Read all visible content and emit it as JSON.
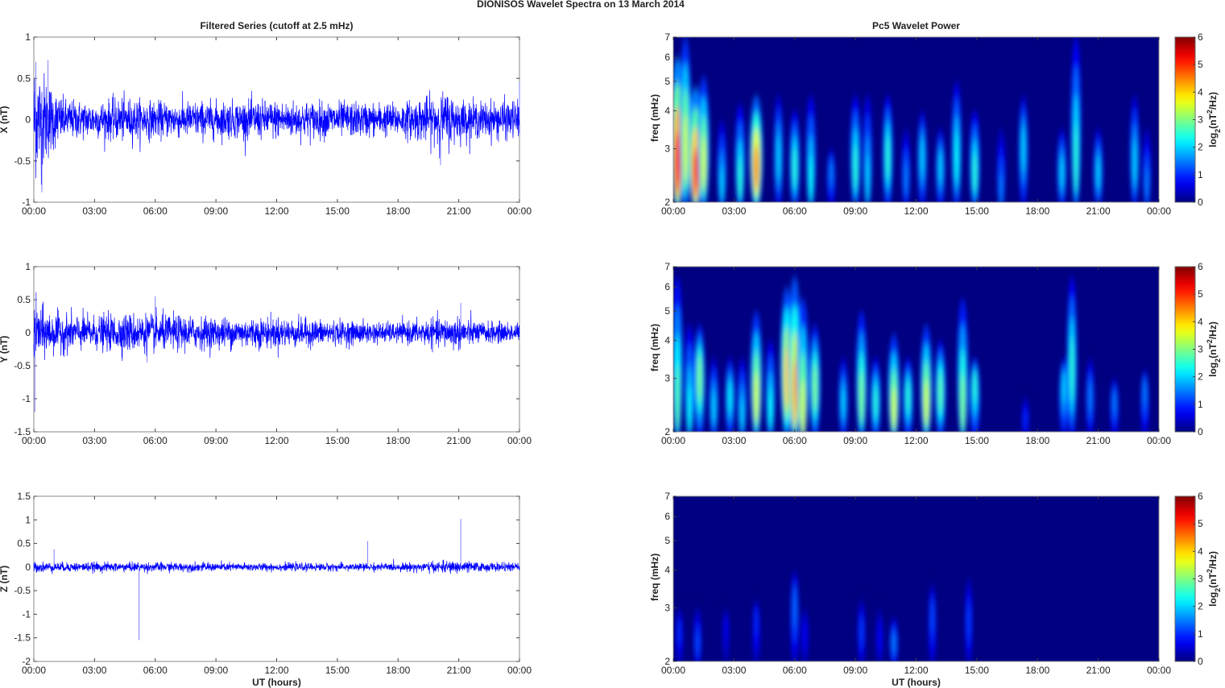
{
  "figure_title": "DIONISOS Wavelet Spectra on 13 March     2014",
  "chart_data": [
    {
      "type": "line",
      "title": "Filtered Series (cutoff at 2.5 mHz)",
      "ylabel": "X (nT)",
      "xlabel": "",
      "ylim": [
        -1,
        1
      ],
      "yticks": [
        "-1",
        "-0.5",
        "0",
        "0.5",
        "1"
      ],
      "xticks": [
        "00:00",
        "03:00",
        "06:00",
        "09:00",
        "12:00",
        "15:00",
        "18:00",
        "21:00",
        "00:00"
      ],
      "xlim_hours": [
        0,
        24
      ],
      "envelope": {
        "hours": [
          0,
          0.5,
          1,
          1.5,
          3,
          4.5,
          6,
          12,
          15,
          18,
          19.5,
          20.5,
          21,
          22,
          23,
          24
        ],
        "amp_nT": [
          0.45,
          0.35,
          0.22,
          0.15,
          0.13,
          0.16,
          0.13,
          0.14,
          0.13,
          0.12,
          0.17,
          0.2,
          0.15,
          0.13,
          0.14,
          0.14
        ]
      },
      "spikes": [
        {
          "hour": 0.1,
          "value_nT": 0.7
        },
        {
          "hour": 0.4,
          "value_nT": -0.88
        },
        {
          "hour": 0.7,
          "value_nT": 0.72
        },
        {
          "hour": 20.1,
          "value_nT": -0.55
        },
        {
          "hour": 24,
          "value_nT": 0.45
        }
      ],
      "color": "#0000ff"
    },
    {
      "type": "line",
      "ylabel": "Y (nT)",
      "xlabel": "",
      "ylim": [
        -1.5,
        1
      ],
      "yticks": [
        "-1.5",
        "-1",
        "-0.5",
        "0",
        "0.5",
        "1"
      ],
      "xticks": [
        "00:00",
        "03:00",
        "06:00",
        "09:00",
        "12:00",
        "15:00",
        "18:00",
        "21:00",
        "00:00"
      ],
      "xlim_hours": [
        0,
        24
      ],
      "envelope": {
        "hours": [
          0,
          0.5,
          1,
          3,
          4.5,
          6,
          9,
          12,
          15,
          18,
          20,
          21,
          22,
          24
        ],
        "amp_nT": [
          0.3,
          0.22,
          0.18,
          0.15,
          0.18,
          0.17,
          0.14,
          0.14,
          0.11,
          0.09,
          0.13,
          0.15,
          0.1,
          0.09
        ]
      },
      "spikes": [
        {
          "hour": 0.05,
          "value_nT": -1.2
        },
        {
          "hour": 0.1,
          "value_nT": 0.6
        },
        {
          "hour": 6.0,
          "value_nT": 0.55
        },
        {
          "hour": 5.6,
          "value_nT": -0.45
        },
        {
          "hour": 21.1,
          "value_nT": 0.45
        }
      ],
      "color": "#0000ff"
    },
    {
      "type": "line",
      "ylabel": "Z (nT)",
      "xlabel": "UT (hours)",
      "ylim": [
        -2,
        1.5
      ],
      "yticks": [
        "-2",
        "-1.5",
        "-1",
        "-0.5",
        "0",
        "0.5",
        "1",
        "1.5"
      ],
      "xticks": [
        "00:00",
        "03:00",
        "06:00",
        "09:00",
        "12:00",
        "15:00",
        "18:00",
        "21:00",
        "00:00"
      ],
      "xlim_hours": [
        0,
        24
      ],
      "envelope": {
        "hours": [
          0,
          1,
          6,
          12,
          18,
          20,
          21,
          22,
          24
        ],
        "amp_nT": [
          0.07,
          0.06,
          0.06,
          0.05,
          0.05,
          0.07,
          0.08,
          0.06,
          0.05
        ]
      },
      "spikes": [
        {
          "hour": 5.2,
          "value_nT": -1.55
        },
        {
          "hour": 16.5,
          "value_nT": 0.55
        },
        {
          "hour": 21.1,
          "value_nT": 1.02
        },
        {
          "hour": 1.0,
          "value_nT": 0.38
        }
      ],
      "color": "#0000ff"
    },
    {
      "type": "heatmap",
      "title": "Pc5 Wavelet Power",
      "ylabel": "freq (mHz)",
      "xlabel": "",
      "yscale": "log",
      "ylim": [
        2,
        7
      ],
      "yticks": [
        "2",
        "3",
        "4",
        "5",
        "6",
        "7"
      ],
      "xticks": [
        "00:00",
        "03:00",
        "06:00",
        "09:00",
        "12:00",
        "15:00",
        "18:00",
        "21:00",
        "00:00"
      ],
      "colorbar": {
        "label": "log2(nT2/Hz)",
        "range": [
          0,
          6
        ],
        "ticks": [
          "0",
          "1",
          "2",
          "3",
          "4",
          "5",
          "6"
        ]
      },
      "blobs": [
        [
          0.2,
          2.7,
          6,
          5.2
        ],
        [
          0.6,
          3,
          7,
          3.5
        ],
        [
          1.1,
          2.5,
          4.8,
          5
        ],
        [
          1.5,
          2.7,
          5.2,
          3.5
        ],
        [
          2.4,
          2.3,
          3.7,
          2
        ],
        [
          3.3,
          2.4,
          4.2,
          2.5
        ],
        [
          4.1,
          2.6,
          4.5,
          4.5
        ],
        [
          5.2,
          2.8,
          4.5,
          2
        ],
        [
          6.0,
          2.6,
          4,
          2.5
        ],
        [
          6.8,
          2.4,
          4.5,
          2.3
        ],
        [
          7.8,
          2.5,
          3,
          1.5
        ],
        [
          9.0,
          2.6,
          4.5,
          2.5
        ],
        [
          9.6,
          2.4,
          4.5,
          2
        ],
        [
          10.6,
          2.8,
          4.5,
          2.5
        ],
        [
          11.5,
          2.4,
          3.5,
          1.5
        ],
        [
          12.3,
          2.8,
          4,
          2
        ],
        [
          13.2,
          2.6,
          3.5,
          2
        ],
        [
          14.0,
          2.8,
          5,
          2.3
        ],
        [
          14.9,
          2.5,
          4,
          2.5
        ],
        [
          16.2,
          2.2,
          3.5,
          1.5
        ],
        [
          17.3,
          3,
          4.5,
          2
        ],
        [
          19.2,
          2.5,
          3.5,
          2
        ],
        [
          19.9,
          2.8,
          7,
          2.5
        ],
        [
          21.0,
          2.5,
          3.5,
          2
        ],
        [
          22.8,
          2.7,
          4.5,
          2
        ],
        [
          23.4,
          2.3,
          3.5,
          1.5
        ]
      ]
    },
    {
      "type": "heatmap",
      "ylabel": "freq (mHz)",
      "xlabel": "",
      "yscale": "log",
      "ylim": [
        2,
        7
      ],
      "yticks": [
        "2",
        "3",
        "4",
        "5",
        "6",
        "7"
      ],
      "xticks": [
        "00:00",
        "03:00",
        "06:00",
        "09:00",
        "12:00",
        "15:00",
        "18:00",
        "21:00",
        "00:00"
      ],
      "colorbar": {
        "label": "log2(nT2/Hz)",
        "range": [
          0,
          6
        ],
        "ticks": [
          "0",
          "1",
          "2",
          "3",
          "4",
          "5",
          "6"
        ]
      },
      "blobs": [
        [
          0.2,
          2.6,
          6.5,
          2.8
        ],
        [
          0.8,
          2.4,
          4.5,
          2.3
        ],
        [
          1.3,
          3,
          4.5,
          3
        ],
        [
          2.0,
          2.4,
          3.5,
          2
        ],
        [
          2.8,
          2.6,
          3.5,
          2.2
        ],
        [
          3.4,
          2.3,
          3.5,
          2
        ],
        [
          4.1,
          2.6,
          5,
          3.5
        ],
        [
          4.8,
          2.4,
          4,
          2.3
        ],
        [
          5.6,
          3,
          6,
          4
        ],
        [
          6.0,
          2.7,
          6.5,
          4.2
        ],
        [
          6.4,
          2.4,
          5.5,
          3.5
        ],
        [
          7.0,
          2.8,
          4.5,
          3
        ],
        [
          8.4,
          2.5,
          3.5,
          2
        ],
        [
          9.3,
          2.6,
          5,
          3
        ],
        [
          10.0,
          2.5,
          3.5,
          2.5
        ],
        [
          10.9,
          2.4,
          4.2,
          3.5
        ],
        [
          11.6,
          2.6,
          3.5,
          2.5
        ],
        [
          12.5,
          2.5,
          4.5,
          3.5
        ],
        [
          13.2,
          2.7,
          4,
          2.8
        ],
        [
          14.3,
          2.5,
          5.5,
          3
        ],
        [
          14.9,
          2.8,
          3.5,
          2.5
        ],
        [
          17.4,
          2.2,
          2.6,
          1
        ],
        [
          19.3,
          2.8,
          3.5,
          2
        ],
        [
          19.7,
          3.2,
          6.5,
          2.5
        ],
        [
          20.6,
          2.6,
          3.5,
          1.5
        ],
        [
          21.8,
          2.5,
          3,
          1.5
        ],
        [
          23.3,
          2.7,
          3.2,
          1.5
        ]
      ]
    },
    {
      "type": "heatmap",
      "ylabel": "freq (mHz)",
      "xlabel": "UT (hours)",
      "yscale": "log",
      "ylim": [
        2,
        7
      ],
      "yticks": [
        "2",
        "3",
        "4",
        "5",
        "6",
        "7"
      ],
      "xticks": [
        "00:00",
        "03:00",
        "06:00",
        "09:00",
        "12:00",
        "15:00",
        "18:00",
        "21:00",
        "00:00"
      ],
      "colorbar": {
        "label": "log2(nT2/Hz)",
        "range": [
          0,
          6
        ],
        "ticks": [
          "0",
          "1",
          "2",
          "3",
          "4",
          "5",
          "6"
        ]
      },
      "blobs": [
        [
          0.3,
          2.5,
          3,
          1
        ],
        [
          1.2,
          2.3,
          3,
          1.2
        ],
        [
          2.6,
          2.6,
          3,
          0.7
        ],
        [
          4.1,
          2.7,
          3.2,
          1
        ],
        [
          6.0,
          3,
          4,
          1.4
        ],
        [
          6.5,
          2.5,
          3,
          0.8
        ],
        [
          9.3,
          2.5,
          3.2,
          1.1
        ],
        [
          10.2,
          2.4,
          3,
          0.8
        ],
        [
          10.9,
          2.3,
          2.8,
          1.5
        ],
        [
          12.8,
          2.8,
          3.6,
          1.2
        ],
        [
          14.6,
          2.7,
          3.8,
          1.1
        ]
      ]
    }
  ]
}
